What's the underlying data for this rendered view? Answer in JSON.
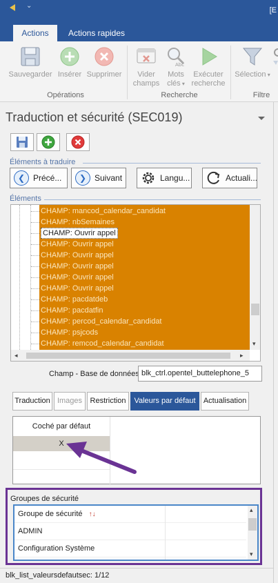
{
  "titlebar": {
    "title_fragment": "[E"
  },
  "ribbon_tabs": [
    {
      "label": "Actions",
      "active": true
    },
    {
      "label": "Actions rapides",
      "active": false
    }
  ],
  "ribbon": {
    "operations": {
      "label": "Opérations",
      "buttons": [
        {
          "label": "Sauvegarder",
          "icon": "save-icon"
        },
        {
          "label": "Insérer",
          "icon": "plus-circle-icon"
        },
        {
          "label": "Supprimer",
          "icon": "close-circle-icon"
        }
      ]
    },
    "recherche": {
      "label": "Recherche",
      "buttons": [
        {
          "line1": "Vider",
          "line2": "champs",
          "icon": "clear-fields-icon"
        },
        {
          "line1": "Mots",
          "line2": "clés",
          "icon": "magnifier-abc-icon"
        },
        {
          "line1": "Exécuter",
          "line2": "recherche",
          "icon": "play-icon"
        }
      ]
    },
    "filtre": {
      "label": "Filtre",
      "buttons": [
        {
          "label": "Sélection",
          "icon": "funnel-icon"
        }
      ]
    }
  },
  "panel": {
    "title": "Traduction et sécurité (SEC019)",
    "section_translate": "Éléments à traduire",
    "section_elements": "Éléments",
    "nav": {
      "prev": "Précé...",
      "next": "Suivant",
      "lang": "Langu...",
      "refresh": "Actuali..."
    },
    "tree_items": [
      "CHAMP: mancod_calendar_candidat",
      "CHAMP: nbSemaines",
      "CHAMP: Ouvrir appel",
      "CHAMP: Ouvrir appel",
      "CHAMP: Ouvrir appel",
      "CHAMP: Ouvrir appel",
      "CHAMP: Ouvrir appel",
      "CHAMP: Ouvrir appel",
      "CHAMP: pacdatdeb",
      "CHAMP: pacdatfin",
      "CHAMP: percod_calendar_candidat",
      "CHAMP: psjcods",
      "CHAMP: remcod_calendar_candidat"
    ],
    "field_label": "Champ - Base de données",
    "field_value": "blk_ctrl.opentel_buttelephone_5",
    "detail_tabs": [
      {
        "label": "Traduction",
        "state": "normal"
      },
      {
        "label": "Images",
        "state": "disabled"
      },
      {
        "label": "Restriction",
        "state": "normal"
      },
      {
        "label": "Valeurs par défaut",
        "state": "active"
      },
      {
        "label": "Actualisation",
        "state": "normal"
      }
    ],
    "defaults_grid": {
      "header": "Coché par défaut",
      "value": "X"
    },
    "security": {
      "title": "Groupes de sécurité",
      "header": "Groupe de sécurité",
      "rows": [
        "ADMIN",
        "Configuration Système"
      ]
    }
  },
  "statusbar": {
    "text": "blk_list_valeursdefautsec: 1/12"
  },
  "colors": {
    "brand": "#2b579a",
    "tree_selection": "#d98200",
    "annotation": "#6a3394"
  }
}
